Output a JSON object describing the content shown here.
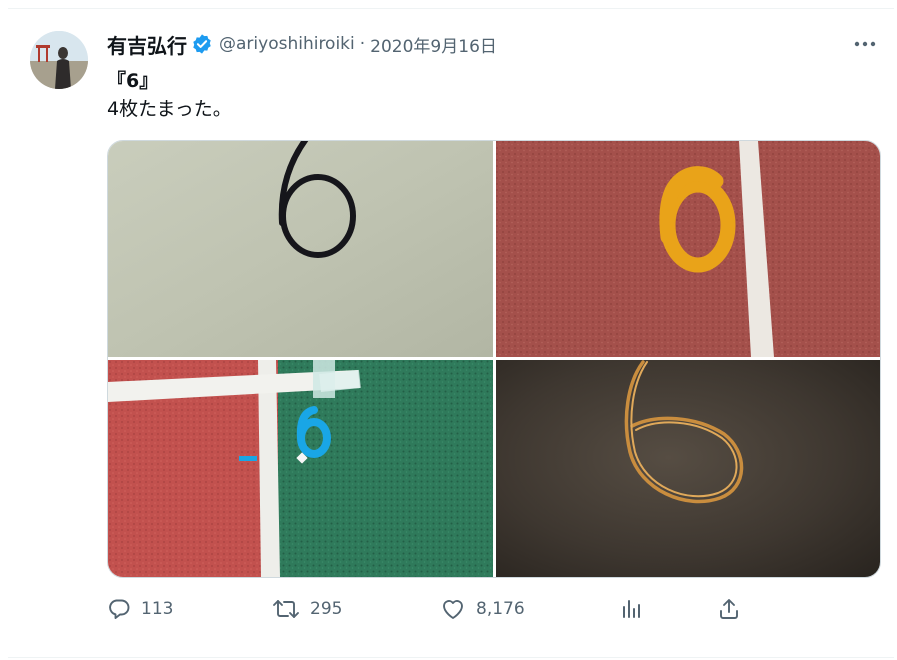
{
  "author": {
    "display_name": "有吉弘行",
    "handle": "@ariyoshihiroiki",
    "separator": "·",
    "date": "2020年9月16日",
    "verified_color": "#1d9bf0"
  },
  "tweet": {
    "line1": "『6』",
    "line2": "4枚たまった。"
  },
  "media": {
    "count": 4,
    "images": [
      "wall-number-6",
      "track-number-6-yellow",
      "track-number-6-blue-tape",
      "rubber-band-6"
    ]
  },
  "actions": {
    "reply_count": "113",
    "retweet_count": "295",
    "like_count": "8,176"
  },
  "icons": [
    "more-icon",
    "reply-icon",
    "retweet-icon",
    "like-icon",
    "views-icon",
    "share-icon"
  ],
  "colors": {
    "text": "#0f1419",
    "secondary": "#536471",
    "accent": "#1d9bf0"
  }
}
